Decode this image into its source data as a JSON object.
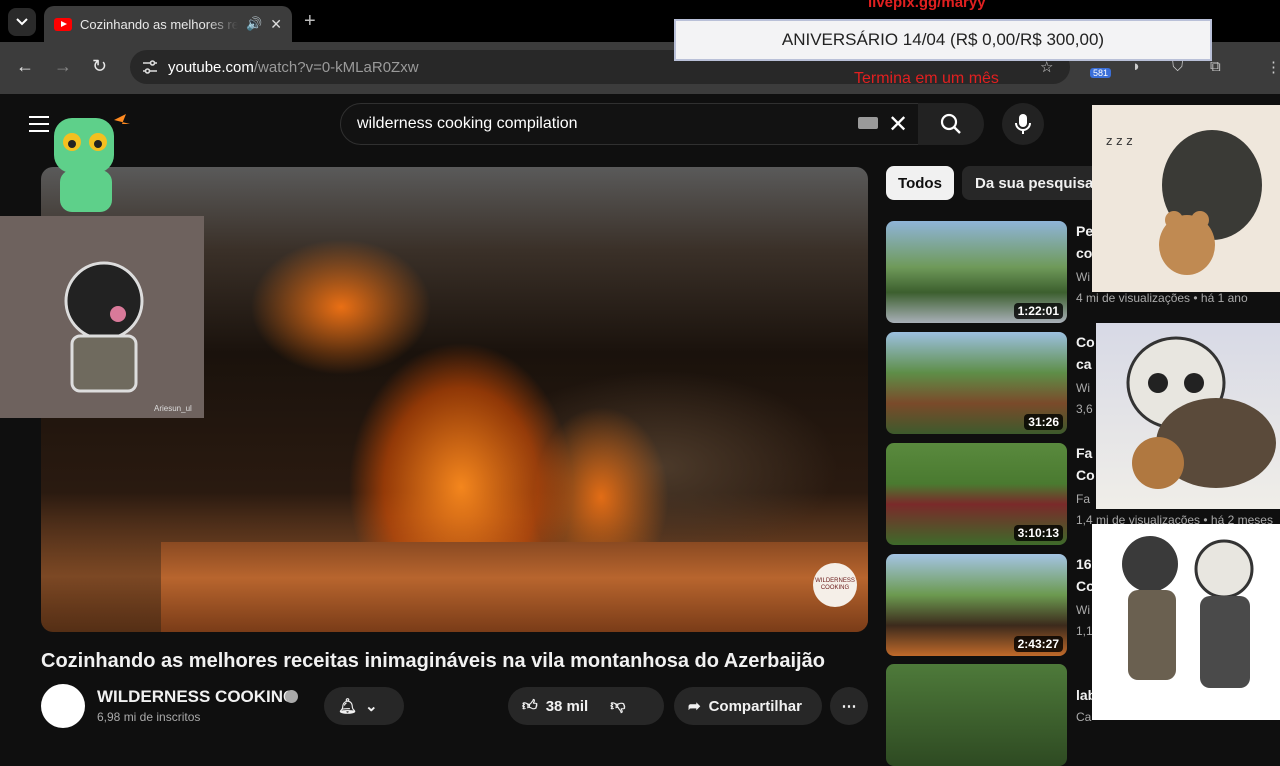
{
  "browser": {
    "tab_title": "Cozinhando as melhores receitas inimagináveis",
    "url_host": "youtube.com",
    "url_path": "/watch?v=0-kMLaR0Zxw",
    "extension_badge": "581"
  },
  "stream_overlay": {
    "top_text": "livepix.gg/maryy",
    "banner": "ANIVERSÁRIO 14/04 (R$ 0,00/R$ 300,00)",
    "bottom_text": "Termina em um mês",
    "art_signature": "Ariesun_ul"
  },
  "youtube": {
    "search_query": "wilderness cooking compilation",
    "video": {
      "title": "Cozinhando as melhores receitas inimagináveis na vila montanhosa do Azerbaijão",
      "channel": "WILDERNESS COOKING",
      "subscribers": "6,98 mi de inscritos",
      "likes": "38 mil",
      "share_label": "Compartilhar",
      "logo_text": "WILDERNESS COOKING"
    },
    "chips": [
      "Todos",
      "Da sua pesquisa"
    ],
    "recommendations": [
      {
        "title": "Pe",
        "title2": "co",
        "channel": "Wi",
        "meta": "4 mi de visualizações • há 1 ano",
        "duration": "1:22:01"
      },
      {
        "title": "Co",
        "title2": "ca",
        "channel": "Wi",
        "meta": "3,6",
        "duration": "31:26"
      },
      {
        "title": "Fa",
        "title2": "Co",
        "channel": "Fa",
        "meta": "1,4 mi de visualizações • há 2 meses",
        "duration": "3:10:13"
      },
      {
        "title": "16",
        "title2": "Co",
        "channel": "Wi",
        "meta": "1,1",
        "duration": "2:43:27"
      },
      {
        "title": "lab",
        "title2": "",
        "channel": "Ca",
        "meta": "",
        "duration": ""
      }
    ]
  },
  "colors": {
    "accent_red": "#ff0000",
    "overlay_red": "#e02020",
    "bg": "#0f0f0f"
  }
}
